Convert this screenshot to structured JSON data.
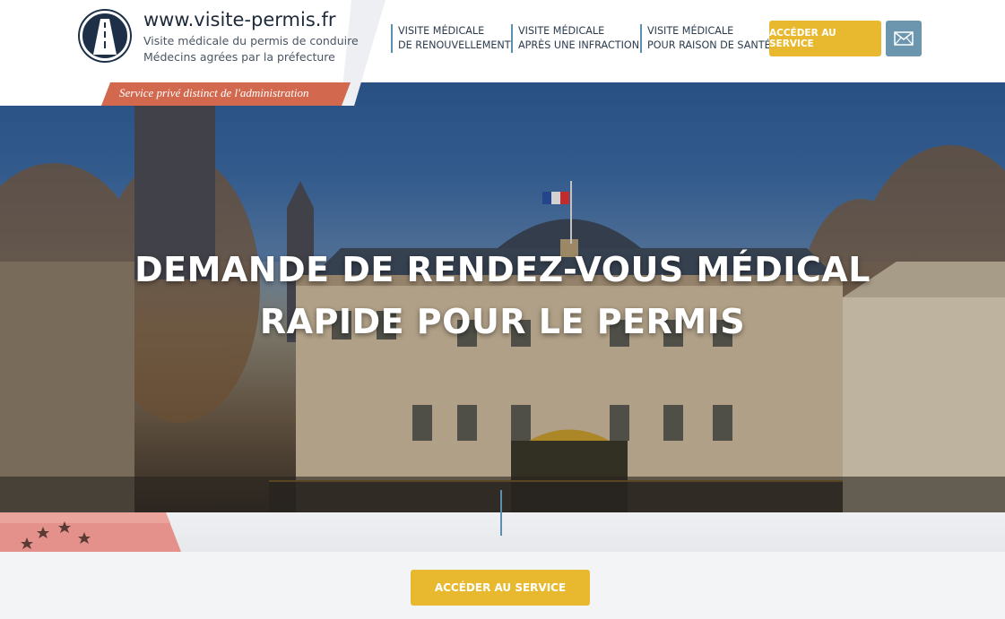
{
  "header": {
    "site_name": "www.visite-permis.fr",
    "subtitle_line1": "Visite médicale du permis de conduire",
    "subtitle_line2": "Médecins agrées par la préfecture",
    "logo_icon": "road-icon",
    "disclaimer": "Service privé distinct de l'administration"
  },
  "nav": {
    "items": [
      {
        "line1": "Visite médicale",
        "line2": "de renouvellement"
      },
      {
        "line1": "Visite médicale",
        "line2": "après une infraction"
      },
      {
        "line1": "Visite médicale",
        "line2": "pour raison de santé"
      }
    ],
    "cta_label": "ACCÉDER AU SERVICE",
    "mail_icon": "envelope-icon"
  },
  "hero": {
    "title_line1": "DEMANDE DE RENDEZ-VOUS MÉDICAL",
    "title_line2": "RAPIDE POUR LE PERMIS"
  },
  "bottom": {
    "cta_label": "ACCÉDER AU SERVICE"
  },
  "colors": {
    "accent_yellow": "#e8b92f",
    "nav_border_blue": "#5b8fb0",
    "disclaimer_red": "#d2694f",
    "mail_button": "#6b96ae",
    "logo_navy": "#1e3048"
  }
}
